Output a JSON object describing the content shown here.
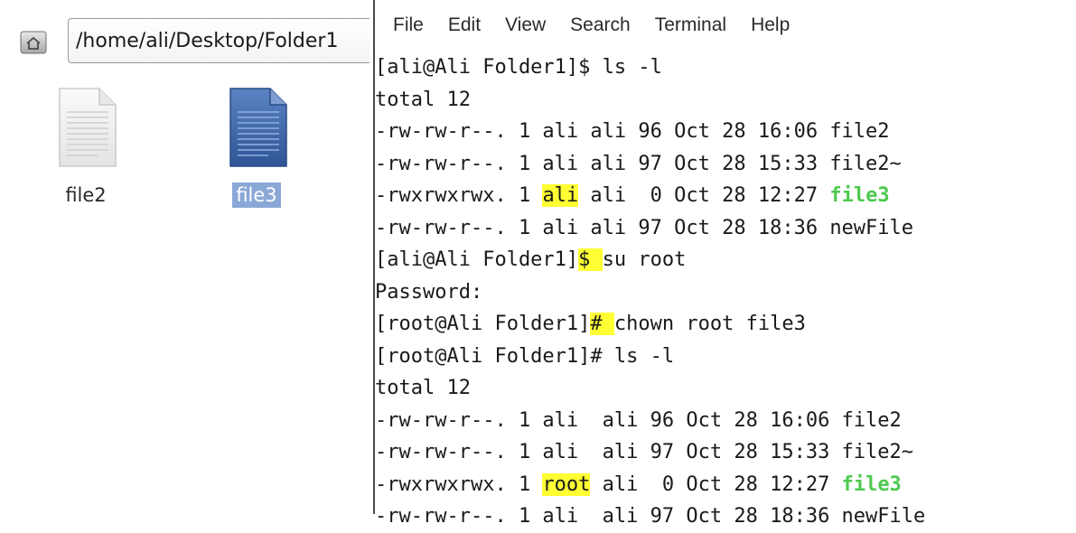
{
  "colors": {
    "highlight": "#ffff33",
    "executable": "#4ec94e",
    "selection": "#8aa8d6",
    "doc_blue": "#3b64a8"
  },
  "file_manager": {
    "home_icon": "home-icon",
    "path": "/home/ali/Desktop/Folder1",
    "files": [
      {
        "name": "file2",
        "icon": "text-document-icon",
        "selected": false
      },
      {
        "name": "file3",
        "icon": "blue-document-icon",
        "selected": true
      }
    ]
  },
  "terminal": {
    "menu": [
      "File",
      "Edit",
      "View",
      "Search",
      "Terminal",
      "Help"
    ],
    "lines": [
      [
        {
          "t": "[ali@Ali Folder1]$ ls -l"
        }
      ],
      [
        {
          "t": "total 12"
        }
      ],
      [
        {
          "t": "-rw-rw-r--. 1 ali ali 96 Oct 28 16:06 file2"
        }
      ],
      [
        {
          "t": "-rw-rw-r--. 1 ali ali 97 Oct 28 15:33 file2~"
        }
      ],
      [
        {
          "t": "-rwxrwxrwx. 1 "
        },
        {
          "t": "ali",
          "hl": true
        },
        {
          "t": " ali  0 Oct 28 12:27 "
        },
        {
          "t": "file3",
          "exe": true
        }
      ],
      [
        {
          "t": "-rw-rw-r--. 1 ali ali 97 Oct 28 18:36 newFile"
        }
      ],
      [
        {
          "t": "[ali@Ali Folder1]"
        },
        {
          "t": "$ ",
          "hl": true
        },
        {
          "t": "su root"
        }
      ],
      [
        {
          "t": "Password:"
        }
      ],
      [
        {
          "t": "[root@Ali Folder1]"
        },
        {
          "t": "# ",
          "hl": true
        },
        {
          "t": "chown root file3"
        }
      ],
      [
        {
          "t": "[root@Ali Folder1]# ls -l"
        }
      ],
      [
        {
          "t": "total 12"
        }
      ],
      [
        {
          "t": "-rw-rw-r--. 1 ali  ali 96 Oct 28 16:06 file2"
        }
      ],
      [
        {
          "t": "-rw-rw-r--. 1 ali  ali 97 Oct 28 15:33 file2~"
        }
      ],
      [
        {
          "t": "-rwxrwxrwx. 1 "
        },
        {
          "t": "root",
          "hl": true
        },
        {
          "t": " ali  0 Oct 28 12:27 "
        },
        {
          "t": "file3",
          "exe": true
        }
      ],
      [
        {
          "t": "-rw-rw-r--. 1 ali  ali 97 Oct 28 18:36 newFile"
        }
      ]
    ]
  }
}
